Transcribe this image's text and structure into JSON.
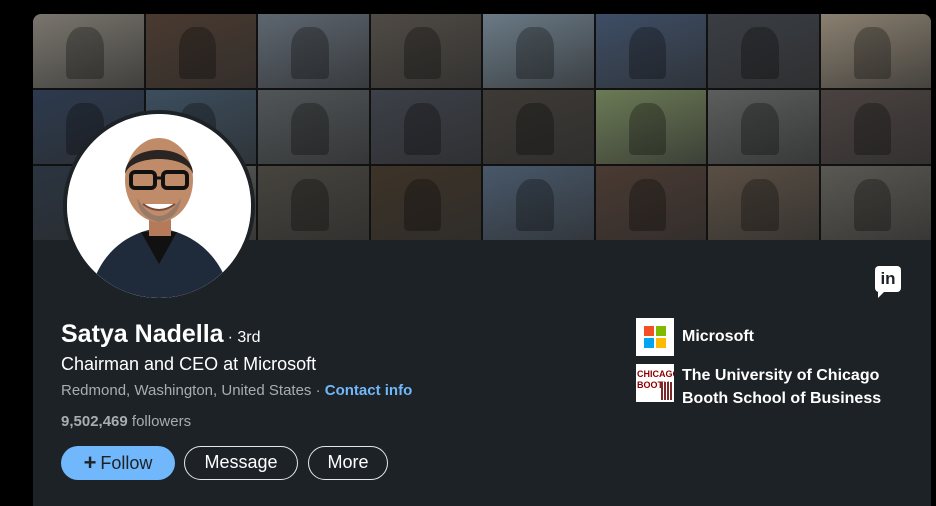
{
  "profile": {
    "name": "Satya Nadella",
    "degree": "· 3rd",
    "headline": "Chairman and CEO at Microsoft",
    "location": "Redmond, Washington, United States",
    "separator": "·",
    "contact_label": "Contact info",
    "followers_count": "9,502,469",
    "followers_label": "followers"
  },
  "actions": {
    "follow_icon": "+",
    "follow_label": "Follow",
    "message_label": "Message",
    "more_label": "More"
  },
  "experience": {
    "company_name": "Microsoft",
    "company_logo": "microsoft-logo",
    "company_colors": [
      "#f25022",
      "#7fba00",
      "#00a4ef",
      "#ffb900"
    ]
  },
  "education": {
    "school_name": "The University of Chicago Booth School of Business",
    "school_logo_text_1": "CHICAGO",
    "school_logo_text_2": "BOOTH"
  },
  "icons": {
    "linkedin": "linkedin-icon",
    "linkedin_glyph": "in"
  },
  "colors": {
    "background": "#000000",
    "card": "#1d2226",
    "primary_button": "#71b7fb",
    "link": "#71b7fb",
    "secondary_text": "#a8adb2"
  },
  "banner": {
    "tile_colors": [
      "#7a766e",
      "#4a3a30",
      "#5d6670",
      "#4f4a44",
      "#6a7a86",
      "#3e4e66",
      "#3a3e44",
      "#8a8070",
      "#2c3a4e",
      "#3c4e5e",
      "#505558",
      "#3c4048",
      "#3e3a36",
      "#6b7a56",
      "#5a5e5c",
      "#4a4240",
      "#2a3440",
      "#5a5c58",
      "#47443e",
      "#3d3328",
      "#48586a",
      "#4a3a32",
      "#5a4f44",
      "#5a5852"
    ]
  }
}
